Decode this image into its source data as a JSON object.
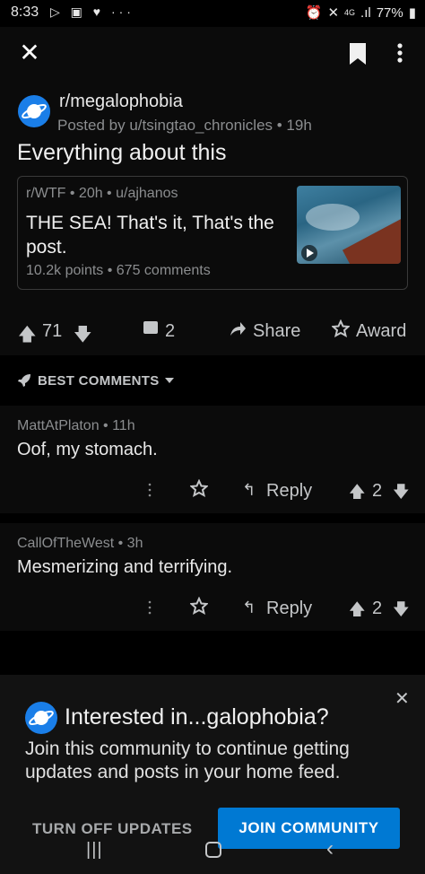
{
  "status_bar": {
    "time": "8:33",
    "left_icons": "▷ ▣ ♥ ···",
    "network": "4G",
    "battery": "77%"
  },
  "app_bar": {
    "close_icon": "✕"
  },
  "post": {
    "subreddit": "r/megalophobia",
    "posted_by": "Posted by u/tsingtao_chronicles • 19h",
    "title": "Everything about this",
    "crosspost": {
      "meta": "r/WTF • 20h • u/ajhanos",
      "title": "THE SEA! That's it, That's the post.",
      "stats": "10.2k points • 675 comments"
    },
    "actions": {
      "up_icon": "🡅",
      "score": "71",
      "down_icon": "🡇",
      "comments": "2",
      "share": "Share",
      "award": "Award"
    }
  },
  "sort": {
    "label": "BEST COMMENTS"
  },
  "comments": [
    {
      "author": "MattAtPlaton • 11h",
      "body": "Oof, my stomach.",
      "reply": "Reply",
      "score": "2"
    },
    {
      "author": "CallOfTheWest • 3h",
      "body": "Mesmerizing and terrifying.",
      "reply": "Reply",
      "score": "2"
    }
  ],
  "interest_sheet": {
    "close_icon": "✕",
    "heading": "Interested in...galophobia?",
    "description": "Join this community to continue getting updates and posts in your home feed.",
    "turn_off": "TURN OFF UPDATES",
    "join": "JOIN COMMUNITY"
  },
  "nav_bar": {
    "recents": "|||",
    "back": "‹"
  },
  "colors": {
    "accent": "#0079d3",
    "avatar": "#1a7ee8",
    "background": "#000000",
    "card": "#0b0b0b"
  }
}
